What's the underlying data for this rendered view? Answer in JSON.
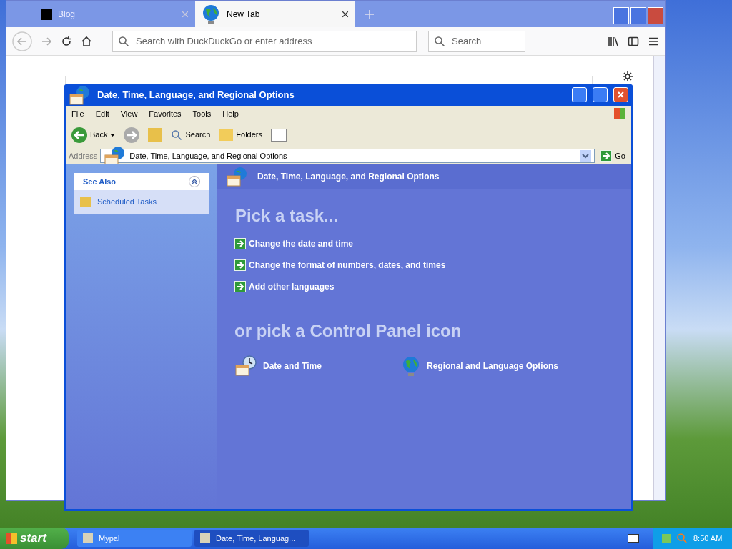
{
  "browser": {
    "tabs": [
      {
        "title": "Blog",
        "selected": false
      },
      {
        "title": "New Tab",
        "selected": true
      }
    ],
    "address": {
      "placeholder": "Search with DuckDuckGo or enter address"
    },
    "search": {
      "placeholder": "Search"
    }
  },
  "explorer": {
    "title": "Date, Time, Language, and Regional Options",
    "menu": [
      "File",
      "Edit",
      "View",
      "Favorites",
      "Tools",
      "Help"
    ],
    "toolbar": {
      "back": "Back",
      "search": "Search",
      "folders": "Folders"
    },
    "address_bar": {
      "label": "Address",
      "value": "Date, Time, Language, and Regional Options",
      "go": "Go"
    },
    "see_also": {
      "title": "See Also",
      "items": [
        "Scheduled Tasks"
      ]
    },
    "header": "Date, Time, Language, and Regional Options",
    "task_heading": "Pick a task...",
    "tasks": [
      "Change the date and time",
      "Change the format of numbers, dates, and times",
      "Add other languages"
    ],
    "icon_heading": "or pick a Control Panel icon",
    "icons": [
      {
        "label": "Date and Time",
        "kind": "clock",
        "hovered": false
      },
      {
        "label": "Regional and Language Options",
        "kind": "globe",
        "hovered": true
      }
    ]
  },
  "taskbar": {
    "start": "start",
    "items": [
      {
        "label": "Mypal",
        "selected": false
      },
      {
        "label": "Date, Time, Languag...",
        "selected": true
      }
    ],
    "clock": "8:50 AM"
  }
}
